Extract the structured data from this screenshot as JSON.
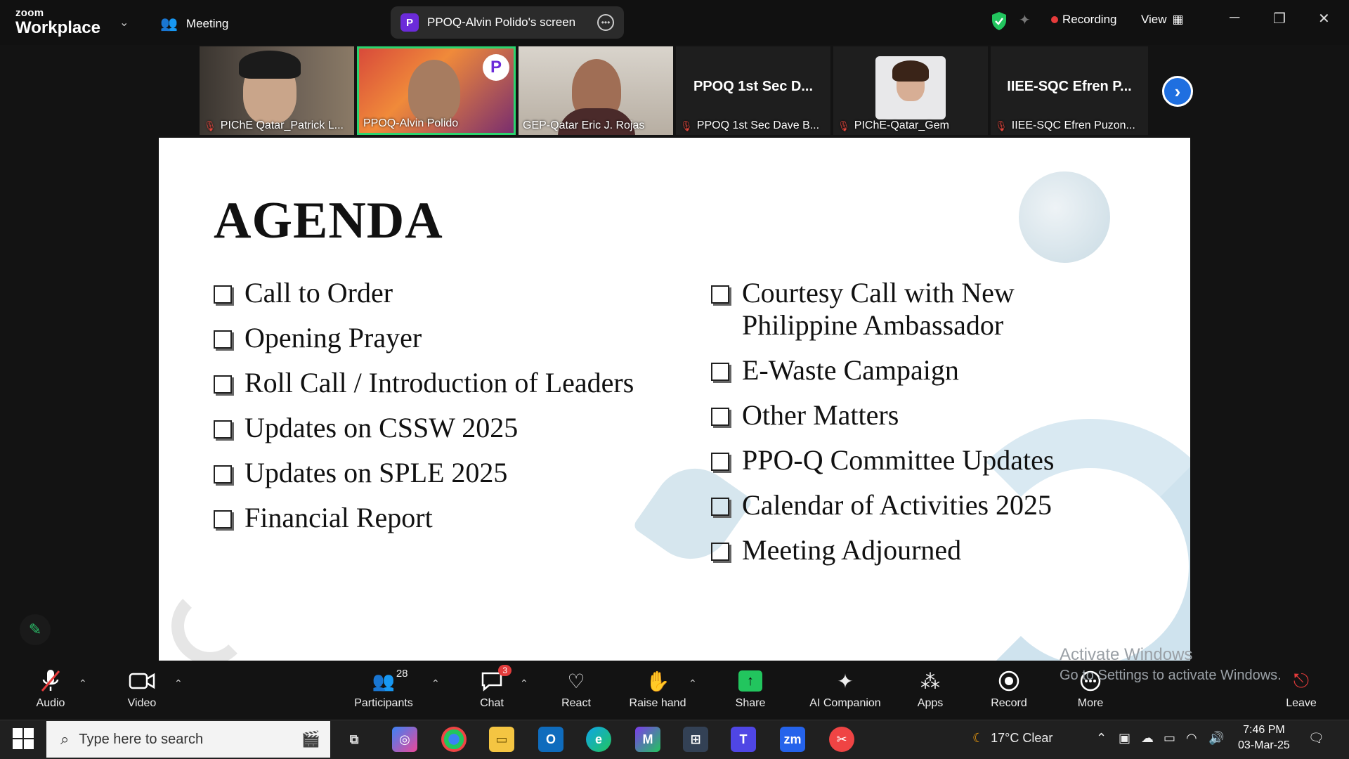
{
  "app": {
    "brand_small": "zoom",
    "brand_big": "Workplace",
    "meeting_label": "Meeting"
  },
  "share_pill": {
    "label": "PPOQ-Alvin Polido's screen",
    "icon_letter": "P"
  },
  "status": {
    "recording": "Recording",
    "view": "View"
  },
  "participants": [
    {
      "name": "PIChE Qatar_Patrick L...",
      "muted": true
    },
    {
      "name": "PPOQ-Alvin Polido",
      "muted": false,
      "active": true
    },
    {
      "name": "GEP-Qatar Eric J. Rojas",
      "muted": false
    },
    {
      "name": "PPOQ 1st Sec Dave B...",
      "label": "PPOQ 1st Sec D...",
      "muted": true
    },
    {
      "name": "PIChE-Qatar_Gem",
      "muted": true
    },
    {
      "name": "IIEE-SQC Efren Puzon...",
      "label": "IIEE-SQC Efren P...",
      "muted": true
    }
  ],
  "slide": {
    "title": "AGENDA",
    "left_items": [
      "Call to Order",
      "Opening Prayer",
      "Roll Call / Introduction of Leaders",
      "Updates on CSSW 2025",
      "Updates on SPLE 2025",
      "Financial Report"
    ],
    "right_items": [
      "Courtesy Call with New Philippine Ambassador",
      "E-Waste Campaign",
      "Other Matters",
      "PPO-Q Committee Updates",
      "Calendar of Activities 2025",
      "Meeting Adjourned"
    ]
  },
  "watermark": {
    "line1": "Activate Windows",
    "line2": "Go to Settings to activate Windows."
  },
  "toolbar": {
    "audio": "Audio",
    "video": "Video",
    "participants": "Participants",
    "participants_count": "28",
    "chat": "Chat",
    "chat_badge": "3",
    "react": "React",
    "raise_hand": "Raise hand",
    "share": "Share",
    "ai_companion": "AI Companion",
    "apps": "Apps",
    "record": "Record",
    "more": "More",
    "leave": "Leave"
  },
  "taskbar": {
    "search_placeholder": "Type here to search",
    "weather": "17°C  Clear",
    "time": "7:46 PM",
    "date": "03-Mar-25"
  },
  "colors": {
    "accent": "#1f6fe0",
    "active_tile": "#2bd46f",
    "share_green": "#22c55e",
    "recording_red": "#e63b3b"
  }
}
